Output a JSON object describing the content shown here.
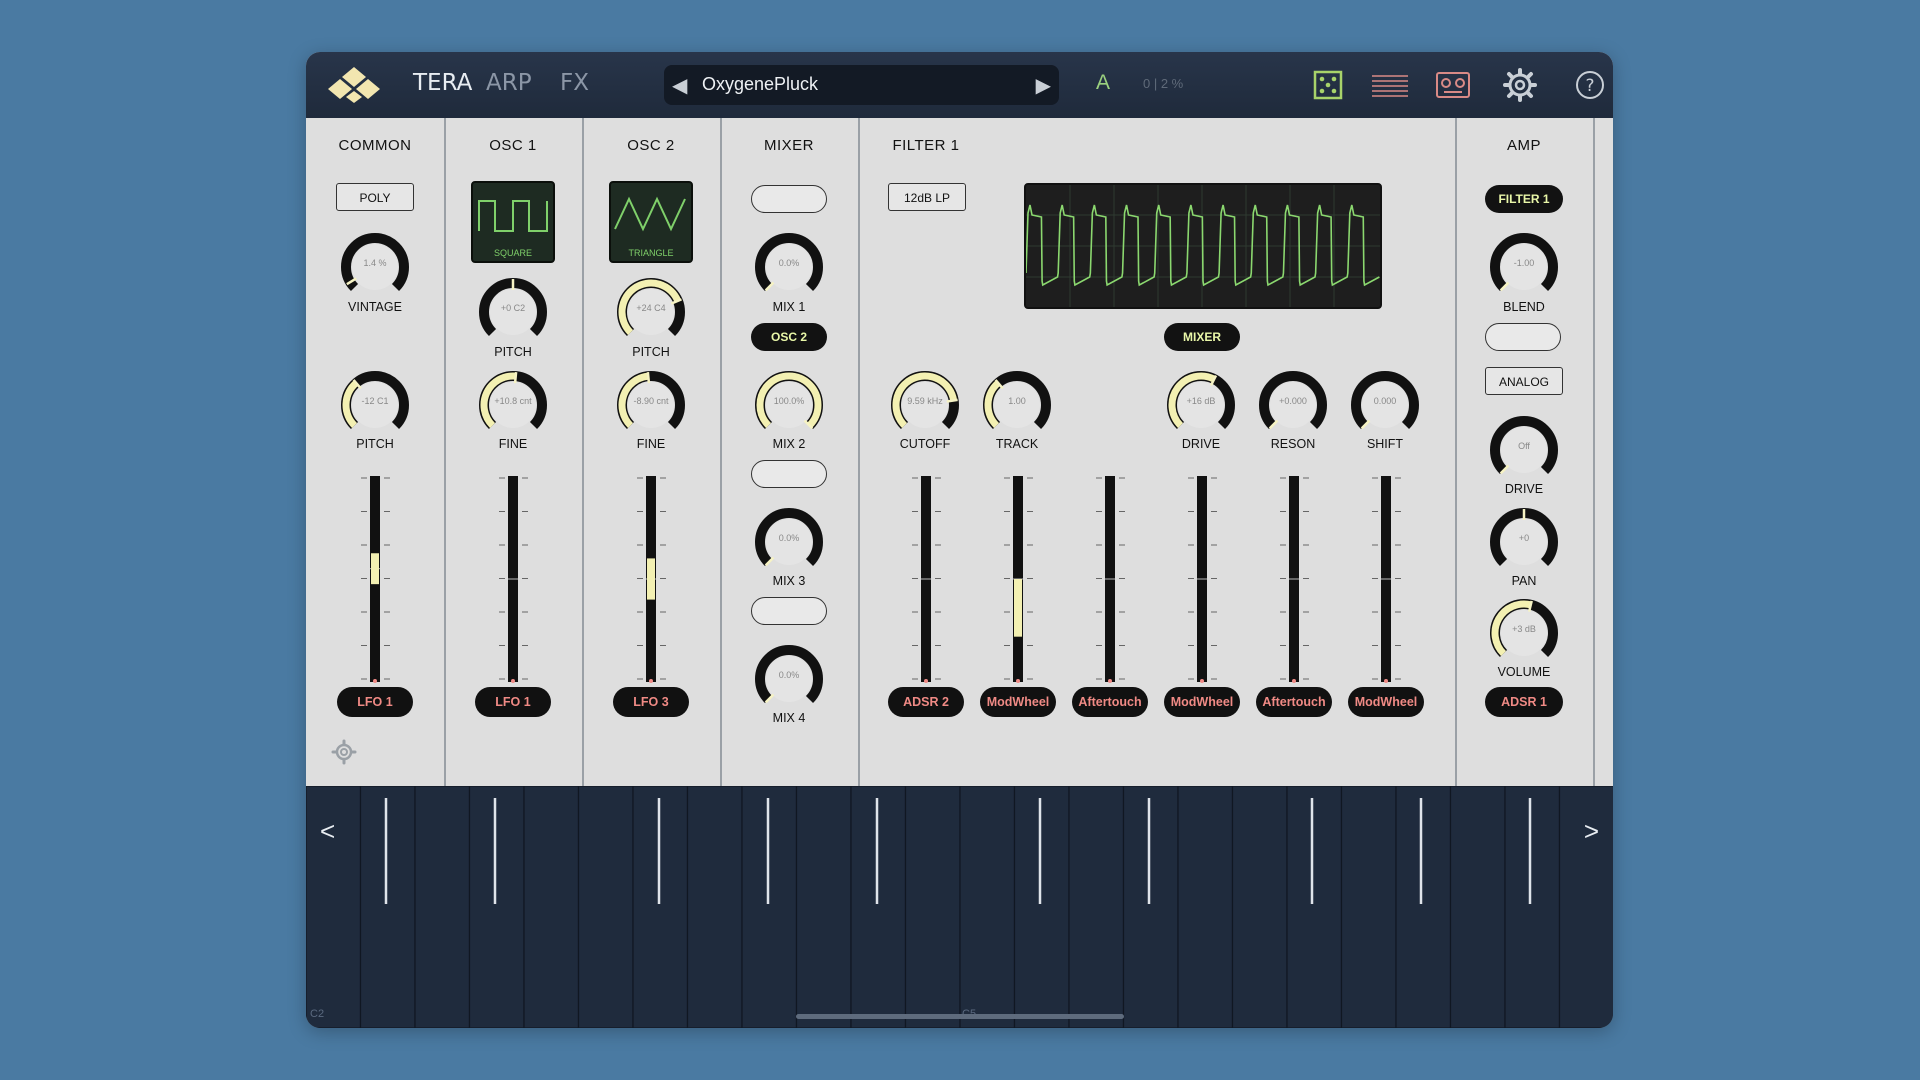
{
  "topbar": {
    "tabs": [
      {
        "label": "TERA",
        "active": true
      },
      {
        "label": "ARP",
        "active": false
      },
      {
        "label": "FX",
        "active": false
      }
    ],
    "preset": {
      "name": "OxygenePluck",
      "prev_icon": "◀",
      "next_icon": "▶"
    },
    "bank": "A",
    "slot": "0 | 2 %",
    "icons": [
      "randomize-dice-icon",
      "list-icon",
      "tape-recorder-icon",
      "gear-icon",
      "help-icon"
    ]
  },
  "sections": {
    "common": "COMMON",
    "osc1": "OSC 1",
    "osc2": "OSC 2",
    "mixer": "MIXER",
    "filter1": "FILTER 1",
    "amp": "AMP"
  },
  "common": {
    "mode_button": "POLY",
    "vintage": {
      "value": "1.4 %",
      "label": "VINTAGE"
    },
    "pitch": {
      "value": "-12 C1",
      "label": "PITCH"
    },
    "mod_source": "LFO 1"
  },
  "osc1": {
    "waveform": "SQUARE",
    "pitch": {
      "value": "+0 C2",
      "label": "PITCH"
    },
    "fine": {
      "value": "+10.8 cnt",
      "label": "FINE"
    },
    "mod_source": "LFO 1"
  },
  "osc2": {
    "waveform": "TRIANGLE",
    "pitch": {
      "value": "+24 C4",
      "label": "PITCH"
    },
    "fine": {
      "value": "-8.90 cnt",
      "label": "FINE"
    },
    "mod_source": "LFO 3"
  },
  "mixer": {
    "mix1": {
      "value": "0.0%",
      "label": "MIX 1"
    },
    "mix2_source": "OSC 2",
    "mix2": {
      "value": "100.0%",
      "label": "MIX 2"
    },
    "mix3": {
      "value": "0.0%",
      "label": "MIX 3"
    },
    "mix4": {
      "value": "0.0%",
      "label": "MIX 4"
    }
  },
  "filter1": {
    "type_button": "12dB LP",
    "scope_source": "MIXER",
    "cutoff": {
      "value": "9.59 kHz",
      "label": "CUTOFF"
    },
    "track": {
      "value": "1.00",
      "label": "TRACK"
    },
    "drive": {
      "value": "+16 dB",
      "label": "DRIVE"
    },
    "reson": {
      "value": "+0.000",
      "label": "RESON"
    },
    "shift": {
      "value": "0.000",
      "label": "SHIFT"
    },
    "mod_sources": [
      "ADSR 2",
      "ModWheel",
      "Aftertouch",
      "ModWheel",
      "Aftertouch",
      "ModWheel"
    ]
  },
  "amp": {
    "source_button": "FILTER 1",
    "blend": {
      "value": "-1.00",
      "label": "BLEND"
    },
    "analog_button": "ANALOG",
    "drive": {
      "value": "Off",
      "label": "DRIVE"
    },
    "pan": {
      "value": "+0",
      "label": "PAN"
    },
    "volume": {
      "value": "+3 dB",
      "label": "VOLUME"
    },
    "mod_source": "ADSR 1"
  },
  "keyboard": {
    "prev": "<",
    "next": ">",
    "octave_labels": [
      "C2",
      "C5"
    ]
  },
  "colors": {
    "accent": "#e9f7a8",
    "mod_text": "#f08a85",
    "scope_wave": "#8bd86f",
    "bank": "#9bd17f"
  }
}
